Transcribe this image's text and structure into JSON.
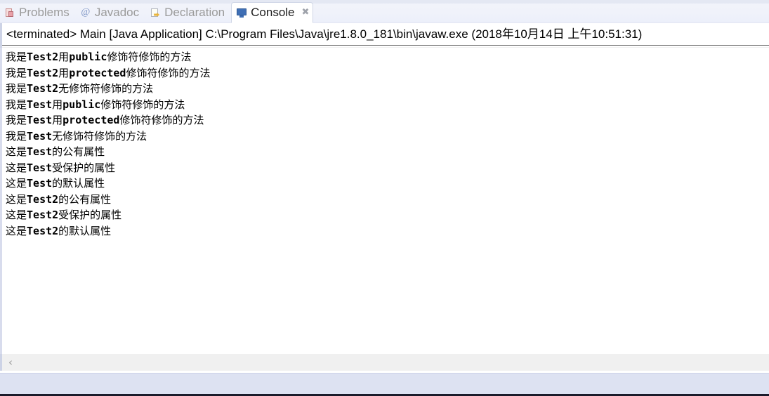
{
  "window": {
    "title": "Eclipse Console View"
  },
  "tabs": [
    {
      "id": "problems",
      "label": "Problems",
      "icon": "problems-icon",
      "active": false,
      "closable": false
    },
    {
      "id": "javadoc",
      "label": "Javadoc",
      "icon": "javadoc-icon",
      "active": false,
      "closable": false
    },
    {
      "id": "declaration",
      "label": "Declaration",
      "icon": "declaration-icon",
      "active": false,
      "closable": false
    },
    {
      "id": "console",
      "label": "Console",
      "icon": "console-icon",
      "active": true,
      "closable": true
    }
  ],
  "tab_close_glyph": "✖",
  "console": {
    "process_header": "<terminated> Main [Java Application] C:\\Program Files\\Java\\jre1.8.0_181\\bin\\javaw.exe (2018年10月14日 上午10:51:31)",
    "process_state": "terminated",
    "launch_name": "Main",
    "launch_type": "Java Application",
    "executable_path": "C:\\Program Files\\Java\\jre1.8.0_181\\bin\\javaw.exe",
    "timestamp": "2018年10月14日 上午10:51:31",
    "output_lines": [
      [
        {
          "t": "我是",
          "s": "cjk"
        },
        {
          "t": "Test2",
          "s": "mono"
        },
        {
          "t": "用",
          "s": "cjk"
        },
        {
          "t": "public",
          "s": "mono"
        },
        {
          "t": "修饰符修饰的方法",
          "s": "cjk"
        }
      ],
      [
        {
          "t": "我是",
          "s": "cjk"
        },
        {
          "t": "Test2",
          "s": "mono"
        },
        {
          "t": "用",
          "s": "cjk"
        },
        {
          "t": "protected",
          "s": "mono"
        },
        {
          "t": "修饰符修饰的方法",
          "s": "cjk"
        }
      ],
      [
        {
          "t": "我是",
          "s": "cjk"
        },
        {
          "t": "Test2",
          "s": "mono"
        },
        {
          "t": "无修饰符修饰的方法",
          "s": "cjk"
        }
      ],
      [
        {
          "t": "我是",
          "s": "cjk"
        },
        {
          "t": "Test",
          "s": "mono"
        },
        {
          "t": "用",
          "s": "cjk"
        },
        {
          "t": "public",
          "s": "mono"
        },
        {
          "t": "修饰符修饰的方法",
          "s": "cjk"
        }
      ],
      [
        {
          "t": "我是",
          "s": "cjk"
        },
        {
          "t": "Test",
          "s": "mono"
        },
        {
          "t": "用",
          "s": "cjk"
        },
        {
          "t": "protected",
          "s": "mono"
        },
        {
          "t": "修饰符修饰的方法",
          "s": "cjk"
        }
      ],
      [
        {
          "t": "我是",
          "s": "cjk"
        },
        {
          "t": "Test",
          "s": "mono"
        },
        {
          "t": "无修饰符修饰的方法",
          "s": "cjk"
        }
      ],
      [
        {
          "t": "这是",
          "s": "cjk"
        },
        {
          "t": "Test",
          "s": "mono"
        },
        {
          "t": "的公有属性",
          "s": "cjk"
        }
      ],
      [
        {
          "t": "这是",
          "s": "cjk"
        },
        {
          "t": "Test",
          "s": "mono"
        },
        {
          "t": "受保护的属性",
          "s": "cjk"
        }
      ],
      [
        {
          "t": "这是",
          "s": "cjk"
        },
        {
          "t": "Test",
          "s": "mono"
        },
        {
          "t": "的默认属性",
          "s": "cjk"
        }
      ],
      [
        {
          "t": "这是",
          "s": "cjk"
        },
        {
          "t": "Test2",
          "s": "mono"
        },
        {
          "t": "的公有属性",
          "s": "cjk"
        }
      ],
      [
        {
          "t": "这是",
          "s": "cjk"
        },
        {
          "t": "Test2",
          "s": "mono"
        },
        {
          "t": "受保护的属性",
          "s": "cjk"
        }
      ],
      [
        {
          "t": "这是",
          "s": "cjk"
        },
        {
          "t": "Test2",
          "s": "mono"
        },
        {
          "t": "的默认属性",
          "s": "cjk"
        }
      ]
    ],
    "output_plain": [
      "我是Test2用public修饰符修饰的方法",
      "我是Test2用protected修饰符修饰的方法",
      "我是Test2无修饰符修饰的方法",
      "我是Test用public修饰符修饰的方法",
      "我是Test用protected修饰符修饰的方法",
      "我是Test无修饰符修饰的方法",
      "这是Test的公有属性",
      "这是Test受保护的属性",
      "这是Test的默认属性",
      "这是Test2的公有属性",
      "这是Test2受保护的属性",
      "这是Test2的默认属性"
    ]
  },
  "scrollbar": {
    "left_arrow_glyph": "‹",
    "orientation": "horizontal"
  },
  "colors": {
    "tabbar_bg": "#f0f2fa",
    "active_tab_bg": "#ffffff",
    "active_tab_border": "#cfd6e6",
    "inactive_tab_text": "#9a9a9a",
    "active_tab_text": "#1d1d1d",
    "console_bg": "#ffffff",
    "console_text": "#000000",
    "header_rule": "#6b6b6b",
    "left_rail": "#cdd3e6",
    "scrollbar_track": "#f0f0f0",
    "scrollbar_arrow": "#9b9b9b",
    "bottom_strip": "#dde2f2",
    "bottom_edge": "#1b1b2b",
    "console_icon": "#3f6fb5"
  }
}
